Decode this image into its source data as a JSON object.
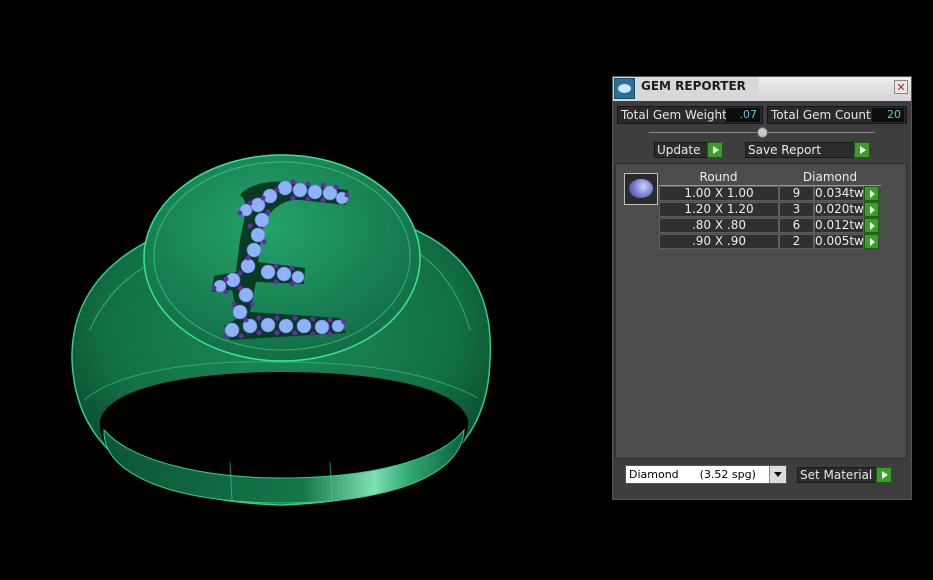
{
  "panel": {
    "title": "GEM REPORTER",
    "stats": {
      "total_weight_label": "Total Gem Weight",
      "total_weight_value": ".07",
      "total_count_label": "Total Gem Count",
      "total_count_value": "20"
    },
    "buttons": {
      "update": "Update",
      "save_report": "Save Report",
      "set_material": "Set Material"
    },
    "table": {
      "shape_header": "Round",
      "material_header": "Diamond",
      "rows": [
        {
          "size": "1.00 X 1.00",
          "count": "9",
          "weight": "0.034tw"
        },
        {
          "size": "1.20 X 1.20",
          "count": "3",
          "weight": "0.020tw"
        },
        {
          "size": ".80 X .80",
          "count": "6",
          "weight": "0.012tw"
        },
        {
          "size": ".90 X .90",
          "count": "2",
          "weight": "0.005tw"
        }
      ]
    },
    "material_select": {
      "value": "Diamond      (3.52 spg)"
    }
  },
  "viewport": {
    "ring_color": "#1f8f5a",
    "gem_color": "#8fb2ff",
    "prong_color": "#6a2aa8",
    "engraved_letter": "£"
  },
  "icons": {
    "app": "gem-reporter-icon",
    "close": "close-icon",
    "shape": "round-diamond-icon"
  }
}
